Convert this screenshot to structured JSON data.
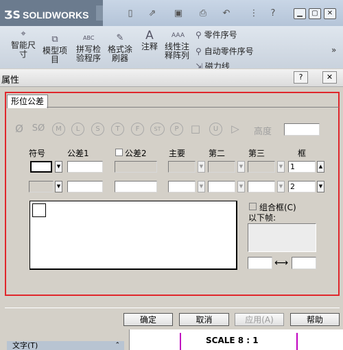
{
  "app": {
    "logo": "SOLIDWORKS",
    "toolbar_icons": [
      "new-icon",
      "open-icon",
      "save-icon",
      "print-icon",
      "undo-icon",
      "traffic-light-icon",
      "help-icon"
    ],
    "ribbon": {
      "items": [
        {
          "label1": "智能尺",
          "label2": "寸"
        },
        {
          "label1": "模型项",
          "label2": "目"
        },
        {
          "label1": "拼写检",
          "label2": "验程序"
        },
        {
          "label1": "格式涂",
          "label2": "刷器"
        },
        {
          "label1": "注释",
          "label2": ""
        },
        {
          "label1": "线性注",
          "label2": "释阵列"
        }
      ],
      "side_items": [
        "零件序号",
        "自动零件序号",
        "磁力线"
      ]
    }
  },
  "dialog": {
    "title": "属性",
    "help_btn": "?",
    "close_btn": "✕",
    "tab": "形位公差",
    "symbols": [
      "Ø",
      "SØ",
      "M",
      "L",
      "S",
      "T",
      "F",
      "ST",
      "P",
      "□",
      "U",
      "▷"
    ],
    "height_label": "高度",
    "columns": {
      "symbol": "符号",
      "tol1": "公差1",
      "tol2": "公差2",
      "primary": "主要",
      "secondary": "第二",
      "tertiary": "第三",
      "frame": "框"
    },
    "rows": [
      {
        "frame_no": "1"
      },
      {
        "frame_no": "2"
      }
    ],
    "combine_label": "组合框(C)",
    "below_label": "以下帧:",
    "buttons": {
      "ok": "确定",
      "cancel": "取消",
      "apply": "应用(A)",
      "help": "帮助"
    }
  },
  "lower": {
    "panel_label": "文字(T)",
    "scale_text": "SCALE 8 : 1"
  }
}
